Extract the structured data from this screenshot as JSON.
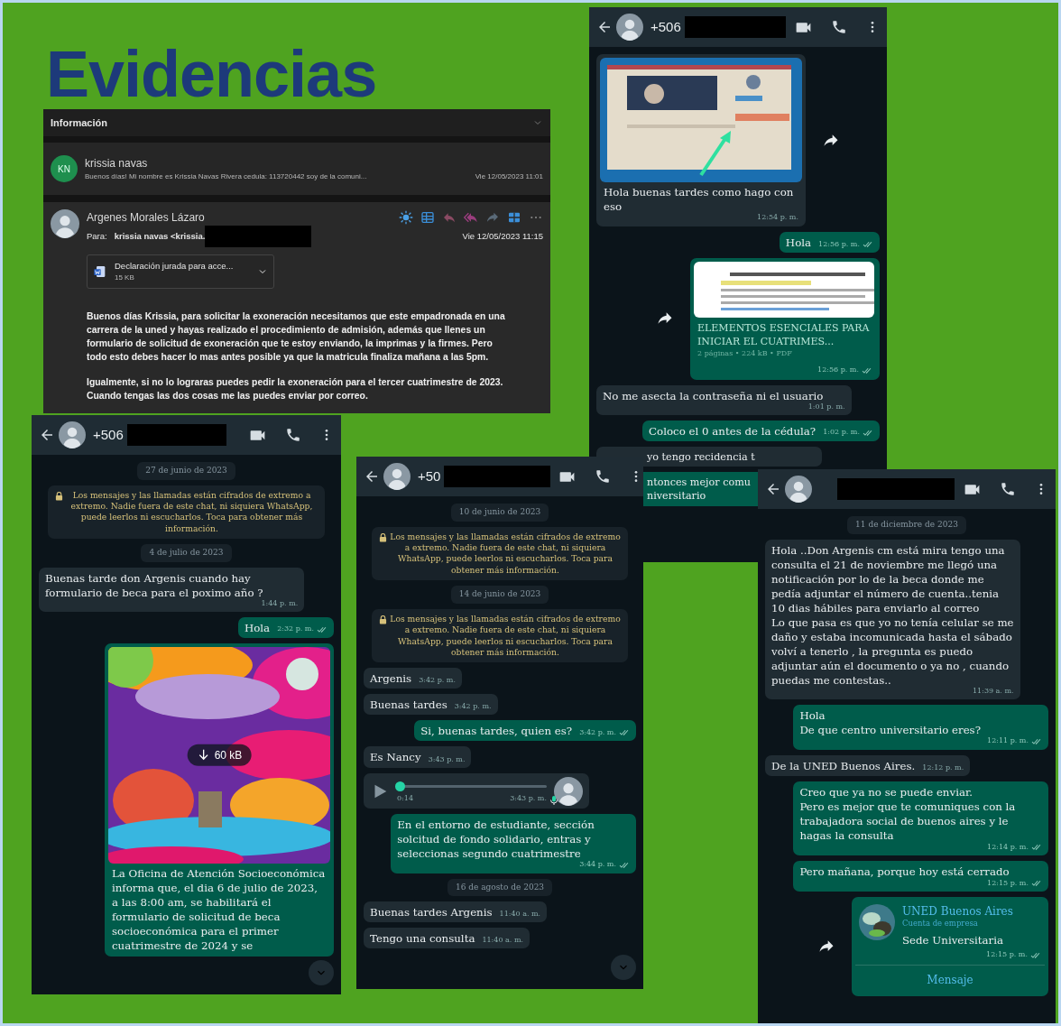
{
  "slide": {
    "title": "Evidencias"
  },
  "email": {
    "section_title": "Información",
    "list_item": {
      "initials": "KN",
      "sender": "krissia navas",
      "preview": "Buenos días! Mi nombre es Krissia Navas Rivera cedula: 113720442 soy de la comuni...",
      "date": "Vie 12/05/2023 11:01"
    },
    "open": {
      "sender": "Argenes Morales Lázaro",
      "to_label": "Para:",
      "to": "krissia navas <krissia.",
      "date": "Vie 12/05/2023 11:15",
      "attachment": {
        "name": "Declaración jurada para acce...",
        "size": "15 KB"
      },
      "body": [
        "Buenos días Krissia, para solicitar la exoneración necesitamos que este empadronada en una carrera de la uned y hayas realizado el procedimiento de admisión, además que llenes un formulario de solicitud de exoneración que te estoy enviando, la imprimas y la firmes. Pero todo esto debes hacer lo mas antes posible ya que la matricula finaliza mañana a las 5pm.",
        "Igualmente, si no lo lograras puedes pedir la exoneración para el tercer cuatrimestre de 2023. Cuando tengas las dos cosas me las puedes enviar por correo."
      ]
    }
  },
  "chats": [
    {
      "phone": "+506",
      "messages": [
        {
          "outgoing": false,
          "caption": "Hola buenas tardes como hago con eso",
          "time": "12:54 p. m.",
          "forward_button": true
        },
        {
          "kind": "text",
          "outgoing": true,
          "text": "Hola",
          "time": "12:56 p. m."
        },
        {
          "kind": "document",
          "outgoing": true,
          "title": "ELEMENTOS ESENCIALES PARA INICIAR EL CUATRIMES...",
          "meta": "2 páginas • 224 kB • PDF",
          "time": "12:56 p. m.",
          "forward_button": true
        },
        {
          "kind": "text",
          "outgoing": false,
          "text": "No me asecta la contraseña ni el usuario",
          "time": "1:01 p. m."
        },
        {
          "kind": "text",
          "outgoing": true,
          "text": "Coloco el 0 antes de la cédula?",
          "time": "1:02 p. m."
        },
        {
          "kind": "cut",
          "outgoing": false,
          "lines": [
            "yo tengo recidencia t"
          ]
        },
        {
          "kind": "cut",
          "outgoing": true,
          "lines": [
            "ntonces mejor comu",
            "niversitario"
          ]
        }
      ]
    },
    {
      "phone": "+506",
      "scroll_button": true,
      "messages": [
        {
          "kind": "date",
          "text": "27 de junio de 2023"
        },
        {
          "kind": "system",
          "text": "Los mensajes y las llamadas están cifrados de extremo a extremo. Nadie fuera de este chat, ni siquiera WhatsApp, puede leerlos ni escucharlos. Toca para obtener más información."
        },
        {
          "kind": "date",
          "text": "4 de julio de 2023"
        },
        {
          "kind": "text",
          "outgoing": false,
          "text": "Buenas tarde don Argenis cuando hay formulario de beca para el poximo año ?",
          "time": "1:44 p. m."
        },
        {
          "kind": "text",
          "outgoing": true,
          "text": "Hola",
          "time": "2:32 p. m."
        },
        {
          "outgoing": true,
          "download": "60 kB",
          "caption": "La Oficina de Atención Socioeconómica informa que, el dia 6 de julio de 2023, a las 8:00 am, se habilitará el formulario de solicitud de beca socioeconómica para el primer cuatrimestre de 2024 y se"
        }
      ]
    },
    {
      "phone": "+50",
      "scroll_button": true,
      "messages": [
        {
          "kind": "date",
          "text": "10 de junio de 2023"
        },
        {
          "kind": "system",
          "text": "Los mensajes y las llamadas están cifrados de extremo a extremo. Nadie fuera de este chat, ni siquiera WhatsApp, puede leerlos ni escucharlos. Toca para obtener más información."
        },
        {
          "kind": "date",
          "text": "14 de junio de 2023"
        },
        {
          "kind": "system",
          "text": "Los mensajes y las llamadas están cifrados de extremo a extremo. Nadie fuera de este chat, ni siquiera WhatsApp, puede leerlos ni escucharlos. Toca para obtener más información."
        },
        {
          "kind": "text",
          "outgoing": false,
          "text": "Argenis",
          "time": "3:42 p. m."
        },
        {
          "kind": "text",
          "outgoing": false,
          "text": "Buenas tardes",
          "time": "3:42 p. m."
        },
        {
          "kind": "text",
          "outgoing": true,
          "text": "Si, buenas tardes, quien es?",
          "time": "3:42 p. m."
        },
        {
          "kind": "text",
          "outgoing": false,
          "text": "Es Nancy",
          "time": "3:43 p. m."
        },
        {
          "kind": "voice",
          "outgoing": false,
          "duration": "0:14",
          "time": "3:43 p. m.",
          "level": 0
        },
        {
          "kind": "text",
          "outgoing": true,
          "text": "En el entorno de estudiante, sección solcitud de fondo solidario, entras y seleccionas segundo cuatrimestre",
          "time": "3:44 p. m."
        },
        {
          "kind": "date",
          "text": "16 de agosto de 2023"
        },
        {
          "kind": "text",
          "outgoing": false,
          "text": "Buenas tardes Argenis",
          "time": "11:40 a. m."
        },
        {
          "kind": "text",
          "outgoing": false,
          "text": "Tengo una consulta",
          "time": "11:40 a. m."
        }
      ]
    },
    {
      "messages": [
        {
          "kind": "date",
          "text": "11 de diciembre de 2023"
        },
        {
          "kind": "text",
          "outgoing": false,
          "text": "Hola ..Don Argenis cm está mira tengo una consulta el 21 de noviembre me llegó una notificación por lo de la beca donde me pedía adjuntar el número de cuenta..tenia 10 dias hábiles para enviarlo al correo\nLo que pasa es que yo no tenía celular se me daño y estaba incomunicada hasta el sábado volví a tenerlo , la pregunta es puedo adjuntar aún el documento o ya no , cuando puedas me contestas..",
          "time": "11:39 a. m."
        },
        {
          "kind": "text",
          "outgoing": true,
          "text": "Hola\nDe que centro universitario eres?",
          "time": "12:11 p. m."
        },
        {
          "kind": "text",
          "outgoing": false,
          "text": "De la UNED Buenos Aires.",
          "time": "12:12 p. m."
        },
        {
          "kind": "text",
          "outgoing": true,
          "text": "Creo que ya no se puede enviar.\nPero es mejor que te comuniques con la trabajadora social de buenos aires y le hagas la consulta",
          "time": "12:14 p. m."
        },
        {
          "kind": "text",
          "outgoing": true,
          "text": "Pero mañana, porque hoy está cerrado",
          "time": "12:15 p. m."
        },
        {
          "kind": "contact",
          "outgoing": true,
          "name": "UNED Buenos Aires",
          "subtitle": "Cuenta de empresa",
          "text": "Sede Universitaria",
          "time": "12:15 p. m.",
          "button": "Mensaje",
          "forward_button": true
        }
      ]
    }
  ]
}
